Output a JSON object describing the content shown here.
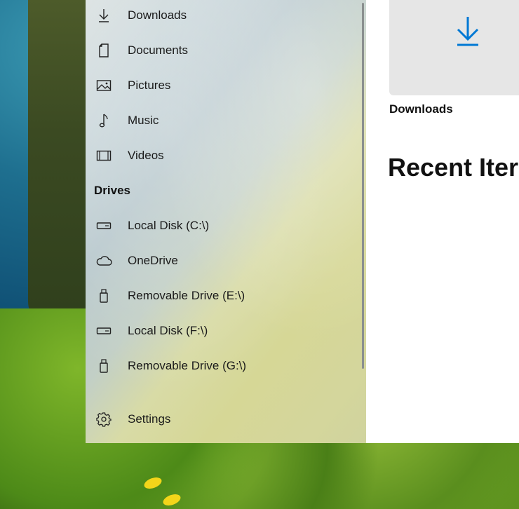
{
  "nav": {
    "items": [
      {
        "label": "Downloads",
        "icon": "download-icon"
      },
      {
        "label": "Documents",
        "icon": "document-icon"
      },
      {
        "label": "Pictures",
        "icon": "picture-icon"
      },
      {
        "label": "Music",
        "icon": "music-icon"
      },
      {
        "label": "Videos",
        "icon": "video-icon"
      }
    ],
    "drives_header": "Drives",
    "drives": [
      {
        "label": "Local Disk (C:\\)",
        "icon": "hard-drive-icon"
      },
      {
        "label": "OneDrive",
        "icon": "cloud-icon"
      },
      {
        "label": "Removable Drive (E:\\)",
        "icon": "usb-drive-icon"
      },
      {
        "label": "Local Disk (F:\\)",
        "icon": "hard-drive-icon"
      },
      {
        "label": "Removable Drive (G:\\)",
        "icon": "usb-drive-icon"
      }
    ],
    "settings_label": "Settings"
  },
  "main": {
    "tile_label": "Downloads",
    "recent_title": "Recent Iter"
  },
  "colors": {
    "accent": "#0078d4",
    "tile_bg": "#e6e6e6"
  }
}
